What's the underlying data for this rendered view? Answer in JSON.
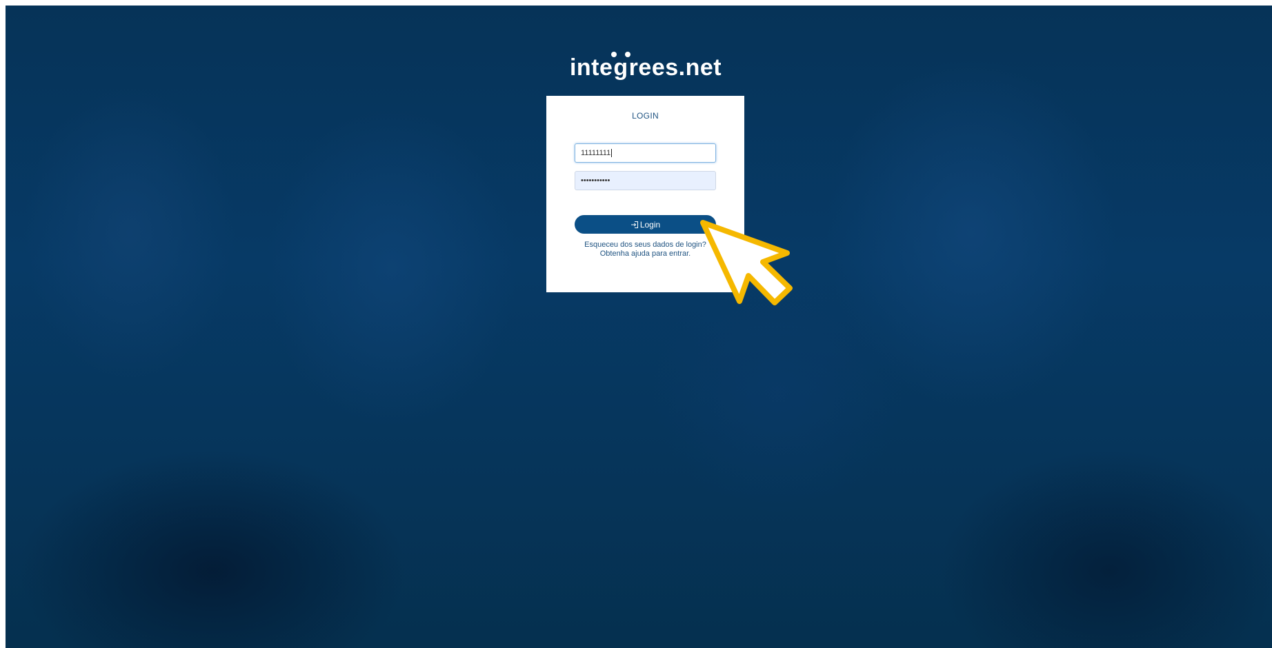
{
  "brand": {
    "logo_before": "inte",
    "logo_g": "g",
    "logo_after": "rees.net"
  },
  "login": {
    "title": "LOGIN",
    "username_value": "11111111",
    "password_value": "•••••••••••",
    "button_label": "Login",
    "forgot_text": "Esqueceu dos seus dados de login?",
    "help_text": "Obtenha ajuda para entrar."
  },
  "colors": {
    "background": "#073a66",
    "accent": "#0b4f86",
    "cursor": "#f5b800"
  },
  "icons": {
    "login_icon": "sign-in-icon",
    "pointer": "arrow-cursor-icon"
  }
}
